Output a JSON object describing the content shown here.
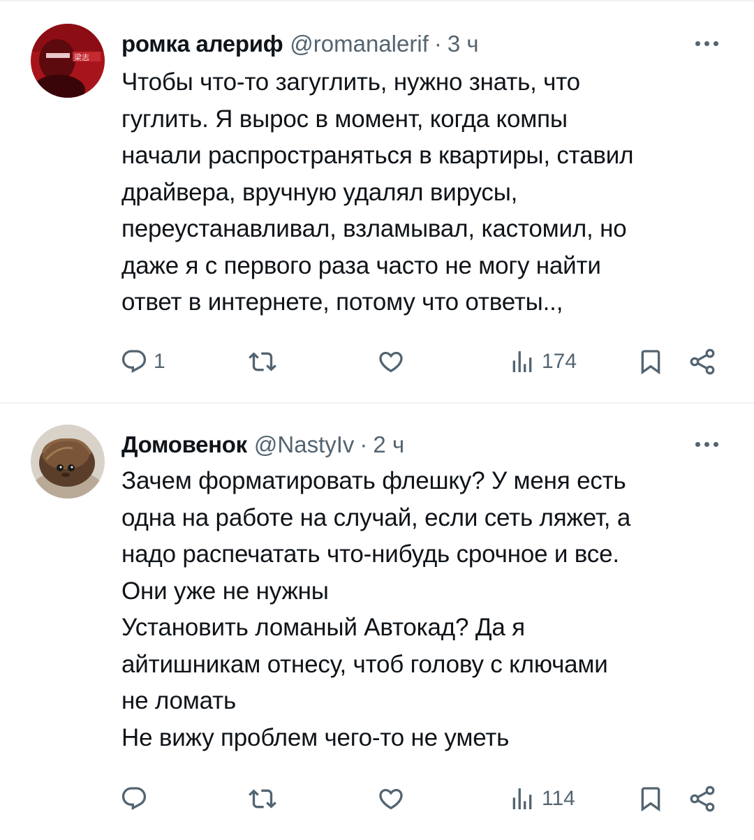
{
  "colors": {
    "text_primary": "#0f1419",
    "text_secondary": "#536471",
    "divider": "#eff3f4",
    "background": "#ffffff"
  },
  "posts": [
    {
      "author": "ромка алериф",
      "handle": "@romanalerif",
      "separator": "·",
      "time": "3 ч",
      "avatar_icon": "red-portrait-avatar",
      "lines": [
        "Чтобы что-то загуглить, нужно знать, что",
        "гуглить. Я вырос в момент, когда компы",
        "начали распространяться в квартиры, ставил",
        "драйвера, вручную удалял вирусы,",
        "переустанавливал, взламывал, кастомил, но",
        "даже я с первого раза часто не могу найти",
        "ответ в интернете, потому что ответы..,"
      ],
      "replies": "1",
      "reposts": "",
      "likes": "",
      "views": "174"
    },
    {
      "author": "Домовенок",
      "handle": "@NastyIv",
      "separator": "·",
      "time": "2 ч",
      "avatar_icon": "domovenok-avatar",
      "lines": [
        "Зачем форматировать флешку? У меня есть",
        "одна на работе на случай, если сеть ляжет, а",
        "надо распечатать что-нибудь срочное и все.",
        "Они уже не нужны",
        "Установить ломаный Автокад? Да я",
        "айтишникам отнесу, чтоб голову с ключами",
        "не ломать",
        "Не вижу проблем чего-то не уметь"
      ],
      "replies": "",
      "reposts": "",
      "likes": "",
      "views": "114"
    }
  ],
  "icons": {
    "reply": "reply-icon",
    "repost": "repost-icon",
    "like": "like-icon",
    "views": "views-icon",
    "bookmark": "bookmark-icon",
    "share": "share-icon",
    "more": "more-icon"
  }
}
